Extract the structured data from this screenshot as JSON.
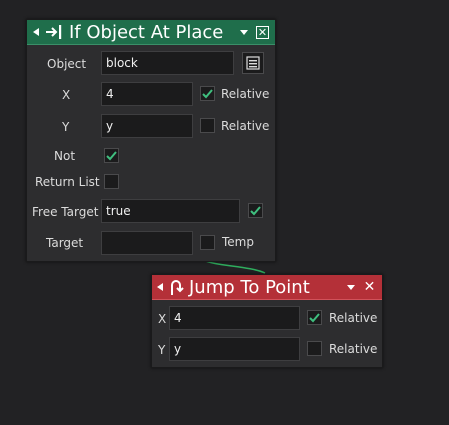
{
  "node1": {
    "title": "If Object At Place",
    "icon": "arrow-to-bar-icon",
    "accent": "#1f6e4b",
    "object_label": "Object",
    "object_value": "block",
    "x_label": "X",
    "x_value": "4",
    "x_relative_label": "Relative",
    "x_relative_checked": true,
    "y_label": "Y",
    "y_value": "y",
    "y_relative_label": "Relative",
    "y_relative_checked": false,
    "not_label": "Not",
    "not_checked": true,
    "return_list_label": "Return List",
    "return_list_checked": false,
    "free_target_label": "Free Target",
    "free_target_value": "true",
    "free_target_checked": true,
    "target_label": "Target",
    "target_value": "",
    "temp_label": "Temp",
    "temp_checked": false
  },
  "node2": {
    "title": "Jump To Point",
    "icon": "jump-arrow-icon",
    "accent": "#b43038",
    "x_label": "X",
    "x_value": "4",
    "x_relative_label": "Relative",
    "x_relative_checked": true,
    "y_label": "Y",
    "y_value": "y",
    "y_relative_label": "Relative",
    "y_relative_checked": false
  },
  "colors": {
    "canvas": "#222224",
    "check": "#3fbf7f",
    "wire": "#2fae5e"
  }
}
